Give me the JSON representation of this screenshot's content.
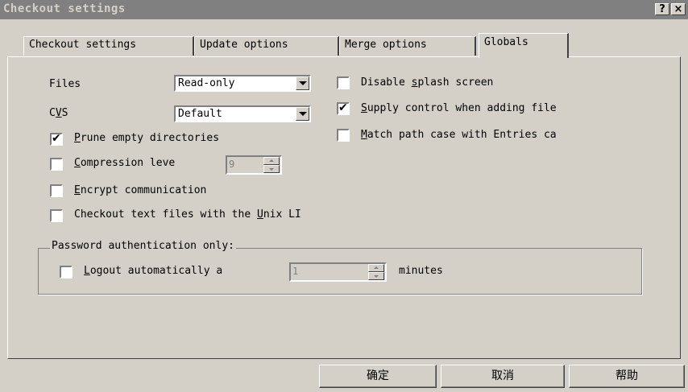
{
  "window": {
    "title": "Checkout settings",
    "help_glyph": "?",
    "close_glyph": "×"
  },
  "tabs": [
    {
      "label": "Checkout settings",
      "active": false
    },
    {
      "label": "Update options",
      "active": false
    },
    {
      "label": "Merge options",
      "active": false
    },
    {
      "label": "Globals",
      "active": true
    }
  ],
  "globals": {
    "files_label": "Files",
    "files_value": "Read-only",
    "cvs_label_pre": "C",
    "cvs_label_u": "V",
    "cvs_label_post": "S",
    "cvs_value": "Default",
    "prune": {
      "u": "P",
      "rest": "rune empty directories",
      "checked": true
    },
    "compression": {
      "u": "C",
      "rest": "ompression leve",
      "checked": false,
      "level": "9"
    },
    "encrypt": {
      "u": "E",
      "rest": "ncrypt communication",
      "checked": false
    },
    "unix_lf": {
      "pre": "Checkout text files with the ",
      "u": "U",
      "rest": "nix LI",
      "checked": false
    },
    "disable_splash": {
      "pre": "Disable ",
      "u": "s",
      "rest": "plash screen",
      "checked": false
    },
    "supply_control": {
      "u": "S",
      "rest": "upply control when adding file",
      "checked": true
    },
    "match_case": {
      "u": "M",
      "rest": "atch path case with Entries ca",
      "checked": false
    }
  },
  "password_group": {
    "title": "Password authentication only:",
    "logout": {
      "u": "L",
      "rest": "ogout automatically a",
      "checked": false,
      "value": "1"
    },
    "minutes_label": "minutes"
  },
  "buttons": {
    "ok": "确定",
    "cancel": "取消",
    "help": "帮助"
  },
  "icons": {
    "check": "✔"
  }
}
